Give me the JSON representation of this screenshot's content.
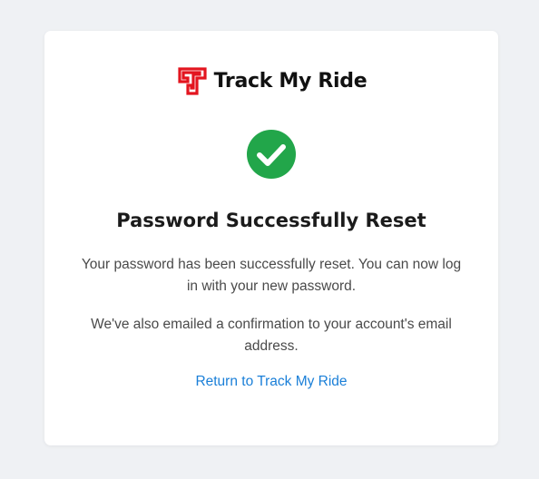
{
  "brand": {
    "name": "Track My Ride",
    "logo_icon": "track-my-ride-logo-icon",
    "logo_color": "#e3151f"
  },
  "status": {
    "icon": "check-circle-icon",
    "color": "#22a64a"
  },
  "heading": "Password Successfully Reset",
  "messages": {
    "reset_confirmation": "Your password has been successfully reset. You can now log in with your new password.",
    "email_confirmation": "We've also emailed a confirmation to your account's email address."
  },
  "links": {
    "return": "Return to Track My Ride",
    "link_color": "#1a7fd8"
  },
  "colors": {
    "page_background": "#eff1f4",
    "card_background": "#ffffff"
  }
}
